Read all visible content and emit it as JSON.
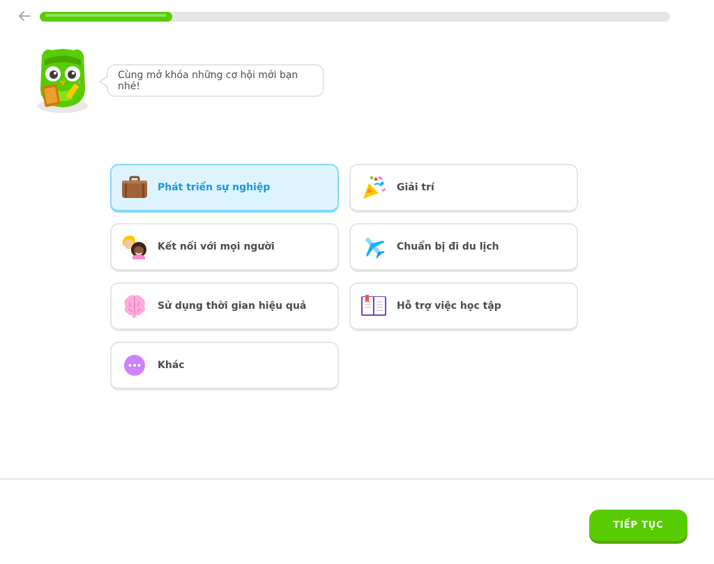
{
  "header": {
    "back_icon": "arrow-left-icon",
    "progress_percent": 21
  },
  "mascot": {
    "speech": "Cùng mở khóa những cơ hội mới bạn nhé!"
  },
  "options": [
    {
      "id": "career",
      "label": "Phát triển sự nghiệp",
      "icon": "briefcase-icon",
      "selected": true
    },
    {
      "id": "fun",
      "label": "Giải trí",
      "icon": "party-popper-icon",
      "selected": false
    },
    {
      "id": "people",
      "label": "Kết nối với mọi người",
      "icon": "people-icon",
      "selected": false
    },
    {
      "id": "travel",
      "label": "Chuẩn bị đi du lịch",
      "icon": "airplane-icon",
      "selected": false
    },
    {
      "id": "brain",
      "label": "Sử dụng thời gian hiệu quả",
      "icon": "brain-icon",
      "selected": false
    },
    {
      "id": "school",
      "label": "Hỗ trợ việc học tập",
      "icon": "book-icon",
      "selected": false
    },
    {
      "id": "other",
      "label": "Khác",
      "icon": "more-dots-icon",
      "selected": false
    }
  ],
  "footer": {
    "continue_label": "TIẾP TỤC"
  },
  "colors": {
    "brand_green": "#58cc02",
    "selected_bg": "#ddf4ff",
    "selected_border": "#84d8ff",
    "selected_text": "#1899d6"
  }
}
